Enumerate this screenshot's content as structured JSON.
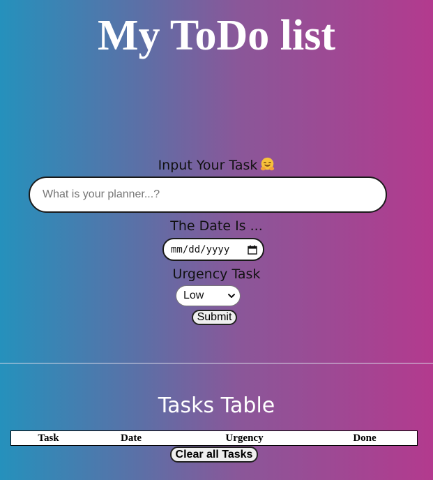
{
  "page": {
    "title": "My ToDo list"
  },
  "form": {
    "task_label": "Input Your Task",
    "task_placeholder": "What is your planner...?",
    "date_label": "The Date Is ...",
    "date_value": "mm/dd/yyyy",
    "urgency_label": "Urgency Task",
    "urgency_selected": "Low",
    "submit_label": "Submit"
  },
  "icons": {
    "task_emoji": "smiling-face-with-open-hands-icon",
    "calendar": "calendar-icon",
    "dropdown": "chevron-down-icon"
  },
  "tasks": {
    "title": "Tasks Table",
    "columns": [
      "Task",
      "Date",
      "Urgency",
      "Done"
    ],
    "rows": [],
    "clear_label": "Clear all Tasks"
  },
  "colors": {
    "gradient_start": "#2591bc",
    "gradient_end": "#b33a8e",
    "title_text": "#ffffff"
  }
}
